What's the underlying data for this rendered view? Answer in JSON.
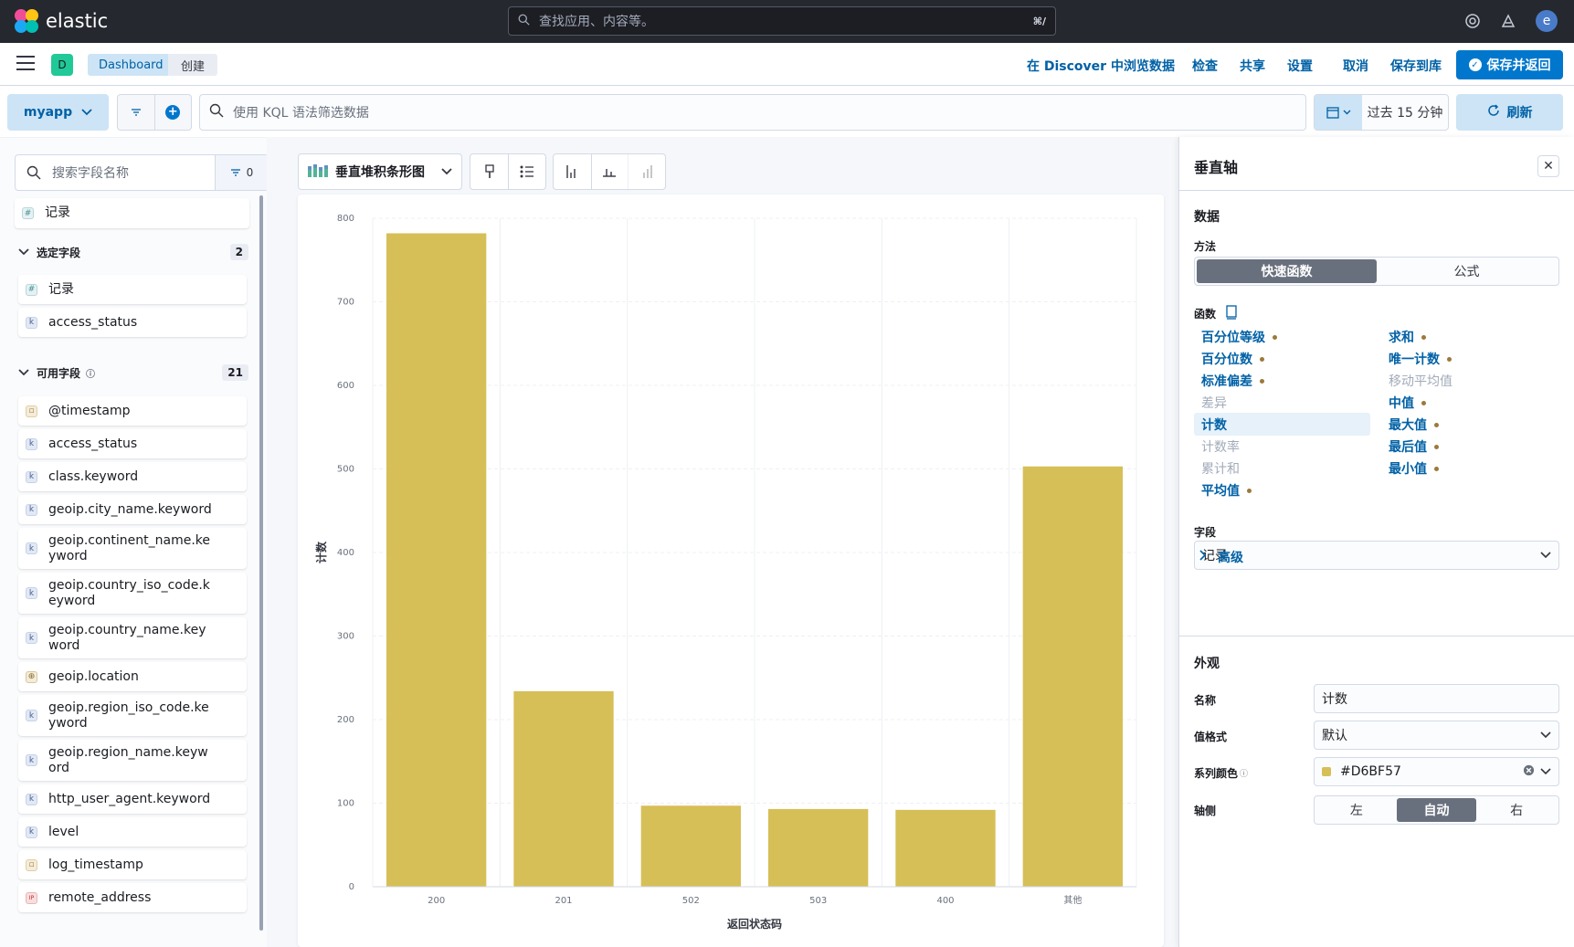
{
  "header": {
    "brand": "elastic",
    "search_placeholder": "查找应用、内容等。",
    "search_shortcut": "⌘/",
    "user_initial": "e"
  },
  "nav": {
    "space_initial": "D",
    "breadcrumbs": [
      "Dashboard",
      "创建"
    ],
    "links": [
      "在 Discover 中浏览数据",
      "检查",
      "共享",
      "设置",
      "取消",
      "保存到库"
    ],
    "save_return": "保存并返回"
  },
  "query": {
    "data_view": "myapp",
    "kql_placeholder": "使用 KQL 语法筛选数据",
    "time_range": "过去 15 分钟",
    "refresh": "刷新"
  },
  "fields": {
    "search_placeholder": "搜索字段名称",
    "filter_count": "0",
    "records_top": "记录",
    "selected_label": "选定字段",
    "selected_count": "2",
    "selected": [
      {
        "name": "记录",
        "type": "#"
      },
      {
        "name": "access_status",
        "type": "k"
      }
    ],
    "available_label": "可用字段",
    "available_count": "21",
    "available": [
      {
        "name": "@timestamp",
        "type": "▫"
      },
      {
        "name": "access_status",
        "type": "k"
      },
      {
        "name": "class.keyword",
        "type": "k"
      },
      {
        "name": "geoip.city_name.keyword",
        "type": "k"
      },
      {
        "name": "geoip.continent_name.ke\nyword",
        "type": "k"
      },
      {
        "name": "geoip.country_iso_code.k\neyword",
        "type": "k"
      },
      {
        "name": "geoip.country_name.key\nword",
        "type": "k"
      },
      {
        "name": "geoip.location",
        "type": "⊕"
      },
      {
        "name": "geoip.region_iso_code.ke\nyword",
        "type": "k"
      },
      {
        "name": "geoip.region_name.keyw\nord",
        "type": "k"
      },
      {
        "name": "http_user_agent.keyword",
        "type": "k"
      },
      {
        "name": "level",
        "type": "k"
      },
      {
        "name": "log_timestamp",
        "type": "▫"
      },
      {
        "name": "remote_address",
        "type": "IP"
      }
    ]
  },
  "toolbar": {
    "viz_type": "垂直堆积条形图"
  },
  "chart_data": {
    "type": "bar",
    "categories": [
      "200",
      "201",
      "502",
      "503",
      "400",
      "其他"
    ],
    "values": [
      782,
      234,
      97,
      93,
      92,
      503
    ],
    "xlabel": "返回状态码",
    "ylabel": "计数",
    "ylim": [
      0,
      800
    ],
    "yticks": [
      0,
      100,
      200,
      300,
      400,
      500,
      600,
      700,
      800
    ],
    "color": "#D6BF57",
    "grid": true
  },
  "panel": {
    "title": "垂直轴",
    "data_section": "数据",
    "method_label": "方法",
    "method_options": [
      "快速函数",
      "公式"
    ],
    "functions_label": "函数",
    "functions_left": [
      {
        "label": "百分位等级",
        "enabled": true
      },
      {
        "label": "百分位数",
        "enabled": true
      },
      {
        "label": "标准偏差",
        "enabled": true
      },
      {
        "label": "差异",
        "enabled": false
      },
      {
        "label": "计数",
        "enabled": true
      },
      {
        "label": "计数率",
        "enabled": false
      },
      {
        "label": "累计和",
        "enabled": false
      },
      {
        "label": "平均值",
        "enabled": true
      }
    ],
    "functions_right": [
      {
        "label": "求和",
        "enabled": true
      },
      {
        "label": "唯一计数",
        "enabled": true
      },
      {
        "label": "移动平均值",
        "enabled": false
      },
      {
        "label": "中值",
        "enabled": true
      },
      {
        "label": "最大值",
        "enabled": true
      },
      {
        "label": "最后值",
        "enabled": true
      },
      {
        "label": "最小值",
        "enabled": true
      }
    ],
    "field_label": "字段",
    "field_value": "记录",
    "advanced": "高级",
    "appearance_section": "外观",
    "name_label": "名称",
    "name_value": "计数",
    "format_label": "值格式",
    "format_value": "默认",
    "color_label": "系列颜色",
    "color_value": "#D6BF57",
    "axis_label": "轴侧",
    "axis_options": [
      "左",
      "自动",
      "右"
    ]
  }
}
